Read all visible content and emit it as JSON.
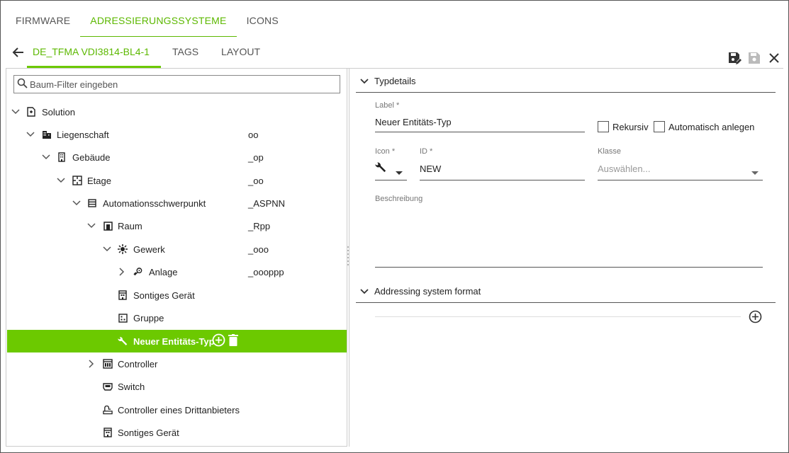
{
  "tabs_top": [
    {
      "label": "FIRMWARE",
      "active": false
    },
    {
      "label": "ADRESSIERUNGSSYSTEME",
      "active": true
    },
    {
      "label": "ICONS",
      "active": false
    }
  ],
  "tabs_sub": [
    {
      "label": "DE_TFMA VDI3814-BL4-1",
      "active": true
    },
    {
      "label": "TAGS",
      "active": false
    },
    {
      "label": "LAYOUT",
      "active": false
    }
  ],
  "toolbar": {
    "save_edit": "save-edit-icon",
    "save": "save-icon",
    "close": "close-icon"
  },
  "filter": {
    "placeholder": "Baum-Filter eingeben"
  },
  "tree": [
    {
      "label": "Solution",
      "code": "",
      "icon": "solution-icon",
      "expander": "down"
    },
    {
      "label": "Liegenschaft",
      "code": "oo",
      "icon": "property-icon",
      "expander": "down"
    },
    {
      "label": "Gebäude",
      "code": "_op",
      "icon": "building-icon",
      "expander": "down"
    },
    {
      "label": "Etage",
      "code": "_oo",
      "icon": "floor-icon",
      "expander": "down"
    },
    {
      "label": "Automationsschwerpunkt",
      "code": "_ASPNN",
      "icon": "rack-icon",
      "expander": "down"
    },
    {
      "label": "Raum",
      "code": "_Rpp",
      "icon": "room-icon",
      "expander": "down"
    },
    {
      "label": "Gewerk",
      "code": "_ooo",
      "icon": "trade-icon",
      "expander": "down"
    },
    {
      "label": "Anlage",
      "code": "_oooppp",
      "icon": "plant-icon",
      "expander": "right"
    },
    {
      "label": "Sontiges Gerät",
      "code": "",
      "icon": "device-icon",
      "expander": ""
    },
    {
      "label": "Gruppe",
      "code": "",
      "icon": "group-icon",
      "expander": ""
    },
    {
      "label": "Neuer Entitäts-Typ",
      "code": "",
      "icon": "wrench-icon",
      "expander": "",
      "selected": true
    },
    {
      "label": "Controller",
      "code": "",
      "icon": "controller-icon",
      "expander": "right"
    },
    {
      "label": "Switch",
      "code": "",
      "icon": "switch-icon",
      "expander": ""
    },
    {
      "label": "Controller eines Drittanbieters",
      "code": "",
      "icon": "third-party-controller-icon",
      "expander": ""
    },
    {
      "label": "Sontiges Gerät",
      "code": "",
      "icon": "device-icon",
      "expander": ""
    }
  ],
  "details": {
    "section_title": "Typdetails",
    "label_caption": "Label *",
    "label_value": "Neuer Entitäts-Typ",
    "rekursiv": "Rekursiv",
    "auto_create": "Automatisch anlegen",
    "icon_caption": "Icon *",
    "id_caption": "ID *",
    "id_value": "NEW",
    "class_caption": "Klasse",
    "class_placeholder": "Auswählen...",
    "description_caption": "Beschreibung"
  },
  "addressing": {
    "section_title": "Addressing system format"
  },
  "colors": {
    "accent": "#6cc900",
    "accent_text": "#5cb800"
  }
}
